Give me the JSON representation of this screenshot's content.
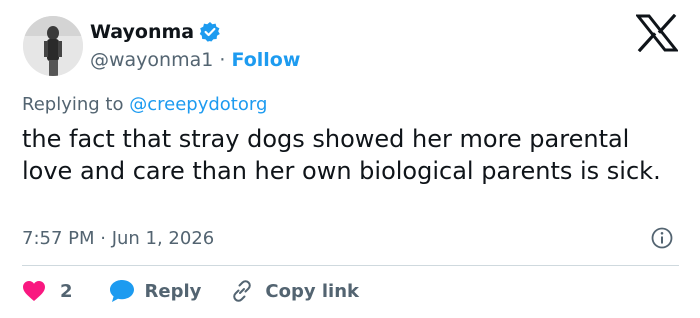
{
  "author": {
    "display_name": "Wayonma",
    "handle": "@wayonma1",
    "separator": "·",
    "follow_label": "Follow",
    "verified_color": "#1d9bf0"
  },
  "reply_context": {
    "prefix": "Replying to",
    "handle": "@creepydotorg"
  },
  "tweet": {
    "text": "the fact that stray dogs showed her more parental love and care than her own biological parents is sick.",
    "timestamp": "7:57 PM · Jun 1, 2026"
  },
  "actions": {
    "like_count": "2",
    "like_color": "#f91880",
    "reply_label": "Reply",
    "reply_color": "#1d9bf0",
    "copy_link_label": "Copy link"
  },
  "icons": {
    "brand": "x-logo-icon",
    "verified": "verified-badge-icon",
    "info": "info-icon",
    "like": "heart-icon",
    "reply": "speech-bubble-icon",
    "copy": "link-icon"
  }
}
